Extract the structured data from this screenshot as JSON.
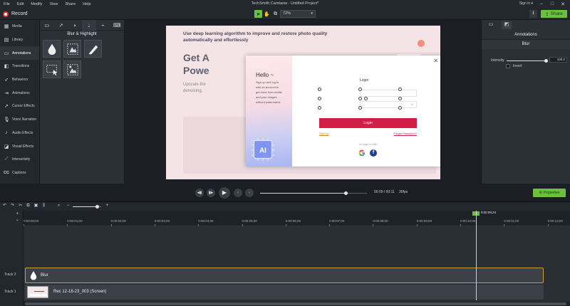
{
  "menu": {
    "items": [
      "File",
      "Edit",
      "Modify",
      "View",
      "Share",
      "Help"
    ],
    "title": "TechSmith Camtasia - Untitled Project*",
    "sign_in": "Sign in ▾"
  },
  "toolbar": {
    "record_label": "Record",
    "zoom_value": "72%",
    "share_label": "Share"
  },
  "sidebar": {
    "items": [
      {
        "label": "Media",
        "icon": "film-icon"
      },
      {
        "label": "Library",
        "icon": "library-icon"
      },
      {
        "label": "Annotations",
        "icon": "annotations-icon"
      },
      {
        "label": "Transitions",
        "icon": "transitions-icon"
      },
      {
        "label": "Behaviors",
        "icon": "behaviors-icon"
      },
      {
        "label": "Animations",
        "icon": "animations-icon"
      },
      {
        "label": "Cursor Effects",
        "icon": "cursor-icon"
      },
      {
        "label": "Voice Narration",
        "icon": "microphone-icon"
      },
      {
        "label": "Audio Effects",
        "icon": "audio-icon"
      },
      {
        "label": "Visual Effects",
        "icon": "visual-effects-icon"
      },
      {
        "label": "Interactivity",
        "icon": "interactivity-icon"
      },
      {
        "label": "Captions",
        "icon": "cc-icon"
      }
    ],
    "active_index": 2
  },
  "annotations_panel": {
    "heading": "Blur & Highlight",
    "tiles": [
      "blur-drop-icon",
      "pixelate-icon",
      "highlight-pen-icon",
      "spotlight-icon",
      "mosaic-icon"
    ]
  },
  "slide": {
    "headline": "Use deep learning algorithm to improve and restore photo quality automatically and effortlessly",
    "big1": "Get A",
    "big2": "Powe",
    "sub1": "Upscale the",
    "sub2": "denoising,"
  },
  "modal": {
    "hello": "Hello ~",
    "lines": [
      "Sign up and log in",
      "with an account to",
      "get more free credits",
      "and your images",
      "without watermarks"
    ],
    "chip_text": "AI",
    "login_title": "Login",
    "eye_glyph": "◎",
    "login_button": "Login",
    "sign_up": "Sign up",
    "forgot": "Forget Password?",
    "or_sign_in": "Or sign in with"
  },
  "properties": {
    "title": "Annotations",
    "subtitle": "Blur",
    "intensity_label": "Intensity",
    "intensity_value": "100.0",
    "intensity_fraction": 1.0,
    "invert_label": "Invert"
  },
  "playback": {
    "time": "00:09 / 00:11",
    "fps": "30fps",
    "progress": 0.8,
    "properties_label": "Properties"
  },
  "timeline": {
    "zoom_fraction": 0.85,
    "ticks": [
      "0:00:00;00",
      "0:00:01;00",
      "0:00:02;00",
      "0:00:03;00",
      "0:00:04;00",
      "0:00:05;00",
      "0:00:06;00",
      "0:00:07;00",
      "0:00:08;00",
      "0:00:09;00",
      "0:00:10;00",
      "0:00:11;00",
      "0:00:12;00"
    ],
    "playhead_time": "0:00:09;24",
    "playhead_fraction": 0.8277,
    "tracks": [
      {
        "label": "Track 2",
        "clip": "Blur"
      },
      {
        "label": "Track 1",
        "clip": "Rec 12-18-23_003 (Screen)"
      }
    ]
  },
  "colors": {
    "accent_green": "#6cc040",
    "login_red": "#cf1f47",
    "clip_border": "#caa133"
  }
}
